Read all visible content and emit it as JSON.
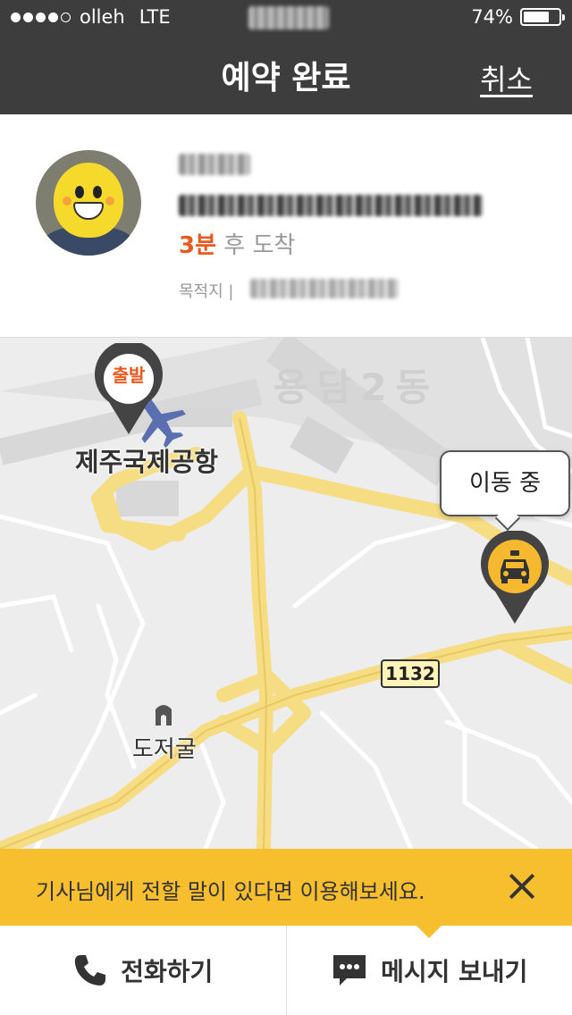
{
  "status_bar": {
    "carrier": "olleh",
    "network": "LTE",
    "battery_percent": "74%",
    "battery_level": 0.74
  },
  "nav": {
    "title": "예약 완료",
    "cancel_label": "취소"
  },
  "driver": {
    "eta_number": "3분",
    "eta_suffix": "후 도착",
    "destination_label": "목적지 |"
  },
  "map": {
    "start_pin_label": "출발",
    "airport_label": "제주국제공항",
    "district_label": "용담2동",
    "cave_label": "도저굴",
    "road_number": "1132",
    "taxi_status": "이동 중"
  },
  "notice": {
    "text": "기사님에게 전할 말이 있다면 이용해보세요."
  },
  "actions": {
    "call_label": "전화하기",
    "message_label": "메시지 보내기"
  },
  "colors": {
    "header": "#3d3d3d",
    "accent_orange": "#e85a1e",
    "notice_yellow": "#f7be2d",
    "taxi_yellow": "#f5b82e"
  }
}
